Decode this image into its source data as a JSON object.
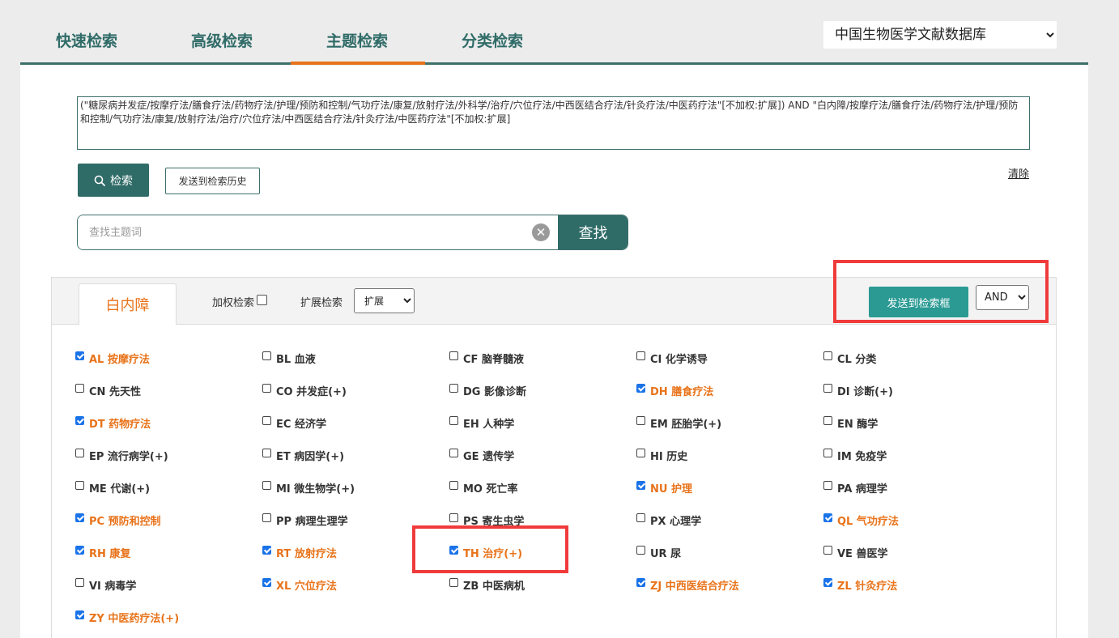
{
  "tabs": [
    {
      "label": "快速检索",
      "active": false
    },
    {
      "label": "高级检索",
      "active": false
    },
    {
      "label": "主题检索",
      "active": true
    },
    {
      "label": "分类检索",
      "active": false
    }
  ],
  "database_select": {
    "value": "中国生物医学文献数据库"
  },
  "query": {
    "text": "(\"糖尿病并发症/按摩疗法/膳食疗法/药物疗法/护理/预防和控制/气功疗法/康复/放射疗法/外科学/治疗/穴位疗法/中西医结合疗法/针灸疗法/中医药疗法\"[不加权:扩展]) AND \"白内障/按摩疗法/膳食疗法/药物疗法/护理/预防和控制/气功疗法/康复/放射疗法/治疗/穴位疗法/中西医结合疗法/针灸疗法/中医药疗法\"[不加权:扩展]"
  },
  "actions": {
    "search_label": "检索",
    "history_label": "发送到检索历史",
    "clear_label": "清除"
  },
  "term_search": {
    "placeholder": "查找主题词",
    "find_label": "查找"
  },
  "subheading_panel": {
    "term": "白内障",
    "weighted_label": "加权检索",
    "expand_label": "扩展检索",
    "expand_value": "扩展",
    "send_label": "发送到检索框",
    "operator_value": "AND"
  },
  "subheadings": [
    {
      "code": "AL",
      "name": "按摩疗法",
      "checked": true
    },
    {
      "code": "BL",
      "name": "血液",
      "checked": false
    },
    {
      "code": "CF",
      "name": "脑脊髓液",
      "checked": false
    },
    {
      "code": "CI",
      "name": "化学诱导",
      "checked": false
    },
    {
      "code": "CL",
      "name": "分类",
      "checked": false
    },
    {
      "code": "CN",
      "name": "先天性",
      "checked": false
    },
    {
      "code": "CO",
      "name": "并发症(+)",
      "checked": false
    },
    {
      "code": "DG",
      "name": "影像诊断",
      "checked": false
    },
    {
      "code": "DH",
      "name": "膳食疗法",
      "checked": true
    },
    {
      "code": "DI",
      "name": "诊断(+)",
      "checked": false
    },
    {
      "code": "DT",
      "name": "药物疗法",
      "checked": true
    },
    {
      "code": "EC",
      "name": "经济学",
      "checked": false
    },
    {
      "code": "EH",
      "name": "人种学",
      "checked": false
    },
    {
      "code": "EM",
      "name": "胚胎学(+)",
      "checked": false
    },
    {
      "code": "EN",
      "name": "酶学",
      "checked": false
    },
    {
      "code": "EP",
      "name": "流行病学(+)",
      "checked": false
    },
    {
      "code": "ET",
      "name": "病因学(+)",
      "checked": false
    },
    {
      "code": "GE",
      "name": "遗传学",
      "checked": false
    },
    {
      "code": "HI",
      "name": "历史",
      "checked": false
    },
    {
      "code": "IM",
      "name": "免疫学",
      "checked": false
    },
    {
      "code": "ME",
      "name": "代谢(+)",
      "checked": false
    },
    {
      "code": "MI",
      "name": "微生物学(+)",
      "checked": false
    },
    {
      "code": "MO",
      "name": "死亡率",
      "checked": false
    },
    {
      "code": "NU",
      "name": "护理",
      "checked": true
    },
    {
      "code": "PA",
      "name": "病理学",
      "checked": false
    },
    {
      "code": "PC",
      "name": "预防和控制",
      "checked": true
    },
    {
      "code": "PP",
      "name": "病理生理学",
      "checked": false
    },
    {
      "code": "PS",
      "name": "寄生虫学",
      "checked": false
    },
    {
      "code": "PX",
      "name": "心理学",
      "checked": false
    },
    {
      "code": "QL",
      "name": "气功疗法",
      "checked": true
    },
    {
      "code": "RH",
      "name": "康复",
      "checked": true
    },
    {
      "code": "RT",
      "name": "放射疗法",
      "checked": true
    },
    {
      "code": "TH",
      "name": "治疗(+)",
      "checked": true
    },
    {
      "code": "UR",
      "name": "尿",
      "checked": false
    },
    {
      "code": "VE",
      "name": "兽医学",
      "checked": false
    },
    {
      "code": "VI",
      "name": "病毒学",
      "checked": false
    },
    {
      "code": "XL",
      "name": "穴位疗法",
      "checked": true
    },
    {
      "code": "ZB",
      "name": "中医病机",
      "checked": false
    },
    {
      "code": "ZJ",
      "name": "中西医结合疗法",
      "checked": true
    },
    {
      "code": "ZL",
      "name": "针灸疗法",
      "checked": true
    },
    {
      "code": "ZY",
      "name": "中医药疗法(+)",
      "checked": true
    }
  ],
  "colors": {
    "primary": "#2f6b67",
    "accent": "#e8731a",
    "send_button": "#2a9a93",
    "annotation": "#f03b3b",
    "checkbox": "#1a73e8"
  }
}
